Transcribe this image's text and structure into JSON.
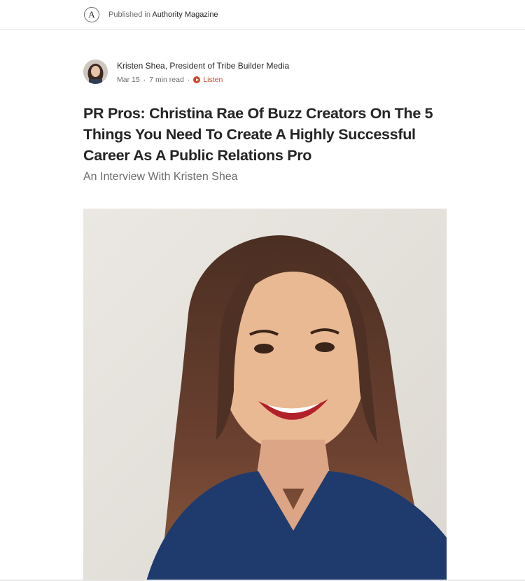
{
  "publication": {
    "logo_letter": "A",
    "published_in_label": "Published in",
    "name": "Authority Magazine"
  },
  "author": {
    "name": "Kristen Shea, President of Tribe Builder Media",
    "date": "Mar 15",
    "separator": "·",
    "read_time": "7 min read",
    "listen_label": "Listen"
  },
  "article": {
    "title": "PR Pros: Christina Rae Of Buzz Creators On The 5 Things You Need To Create A Highly Successful Career As A Public Relations Pro",
    "subtitle": "An Interview With Kristen Shea"
  },
  "colors": {
    "listen_accent": "#c94a2a",
    "text_primary": "#242424",
    "text_secondary": "#6b6b6b"
  }
}
